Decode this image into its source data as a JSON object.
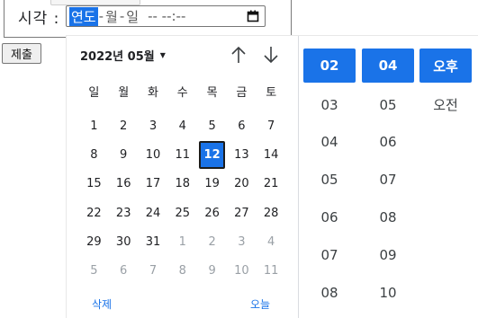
{
  "form": {
    "label": "시각 :",
    "input": {
      "year_placeholder": "연도",
      "month_placeholder": "월",
      "day_placeholder": "일",
      "sep1": "-",
      "sep2": "-",
      "time_placeholder": "-- --:--"
    },
    "submit_label": "제출"
  },
  "picker": {
    "month_label": "2022년 05월",
    "weekdays": [
      "일",
      "월",
      "화",
      "수",
      "목",
      "금",
      "토"
    ],
    "days": [
      {
        "label": "1"
      },
      {
        "label": "2"
      },
      {
        "label": "3"
      },
      {
        "label": "4"
      },
      {
        "label": "5"
      },
      {
        "label": "6"
      },
      {
        "label": "7"
      },
      {
        "label": "8"
      },
      {
        "label": "9"
      },
      {
        "label": "10"
      },
      {
        "label": "11"
      },
      {
        "label": "12",
        "selected": true
      },
      {
        "label": "13"
      },
      {
        "label": "14"
      },
      {
        "label": "15"
      },
      {
        "label": "16"
      },
      {
        "label": "17"
      },
      {
        "label": "18"
      },
      {
        "label": "19"
      },
      {
        "label": "20"
      },
      {
        "label": "21"
      },
      {
        "label": "22"
      },
      {
        "label": "23"
      },
      {
        "label": "24"
      },
      {
        "label": "25"
      },
      {
        "label": "26"
      },
      {
        "label": "27"
      },
      {
        "label": "28"
      },
      {
        "label": "29"
      },
      {
        "label": "30"
      },
      {
        "label": "31"
      },
      {
        "label": "1",
        "muted": true
      },
      {
        "label": "2",
        "muted": true
      },
      {
        "label": "3",
        "muted": true
      },
      {
        "label": "4",
        "muted": true
      },
      {
        "label": "5",
        "muted": true
      },
      {
        "label": "6",
        "muted": true
      },
      {
        "label": "7",
        "muted": true
      },
      {
        "label": "8",
        "muted": true
      },
      {
        "label": "9",
        "muted": true
      },
      {
        "label": "10",
        "muted": true
      },
      {
        "label": "11",
        "muted": true
      }
    ],
    "clear_label": "삭제",
    "today_label": "오늘",
    "hours": [
      "02",
      "03",
      "04",
      "05",
      "06",
      "07",
      "08"
    ],
    "minutes": [
      "04",
      "05",
      "06",
      "07",
      "08",
      "09",
      "10"
    ],
    "ampm": [
      "오후",
      "오전"
    ],
    "selected": {
      "hour": "02",
      "minute": "04",
      "ampm": "오후"
    }
  },
  "colors": {
    "accent": "#1a73e8",
    "text": "#202124",
    "muted": "#9aa0a6"
  },
  "icons": {
    "calendar": "calendar-icon",
    "up": "arrow-up-icon",
    "down": "arrow-down-icon",
    "caret": "caret-down-icon"
  }
}
